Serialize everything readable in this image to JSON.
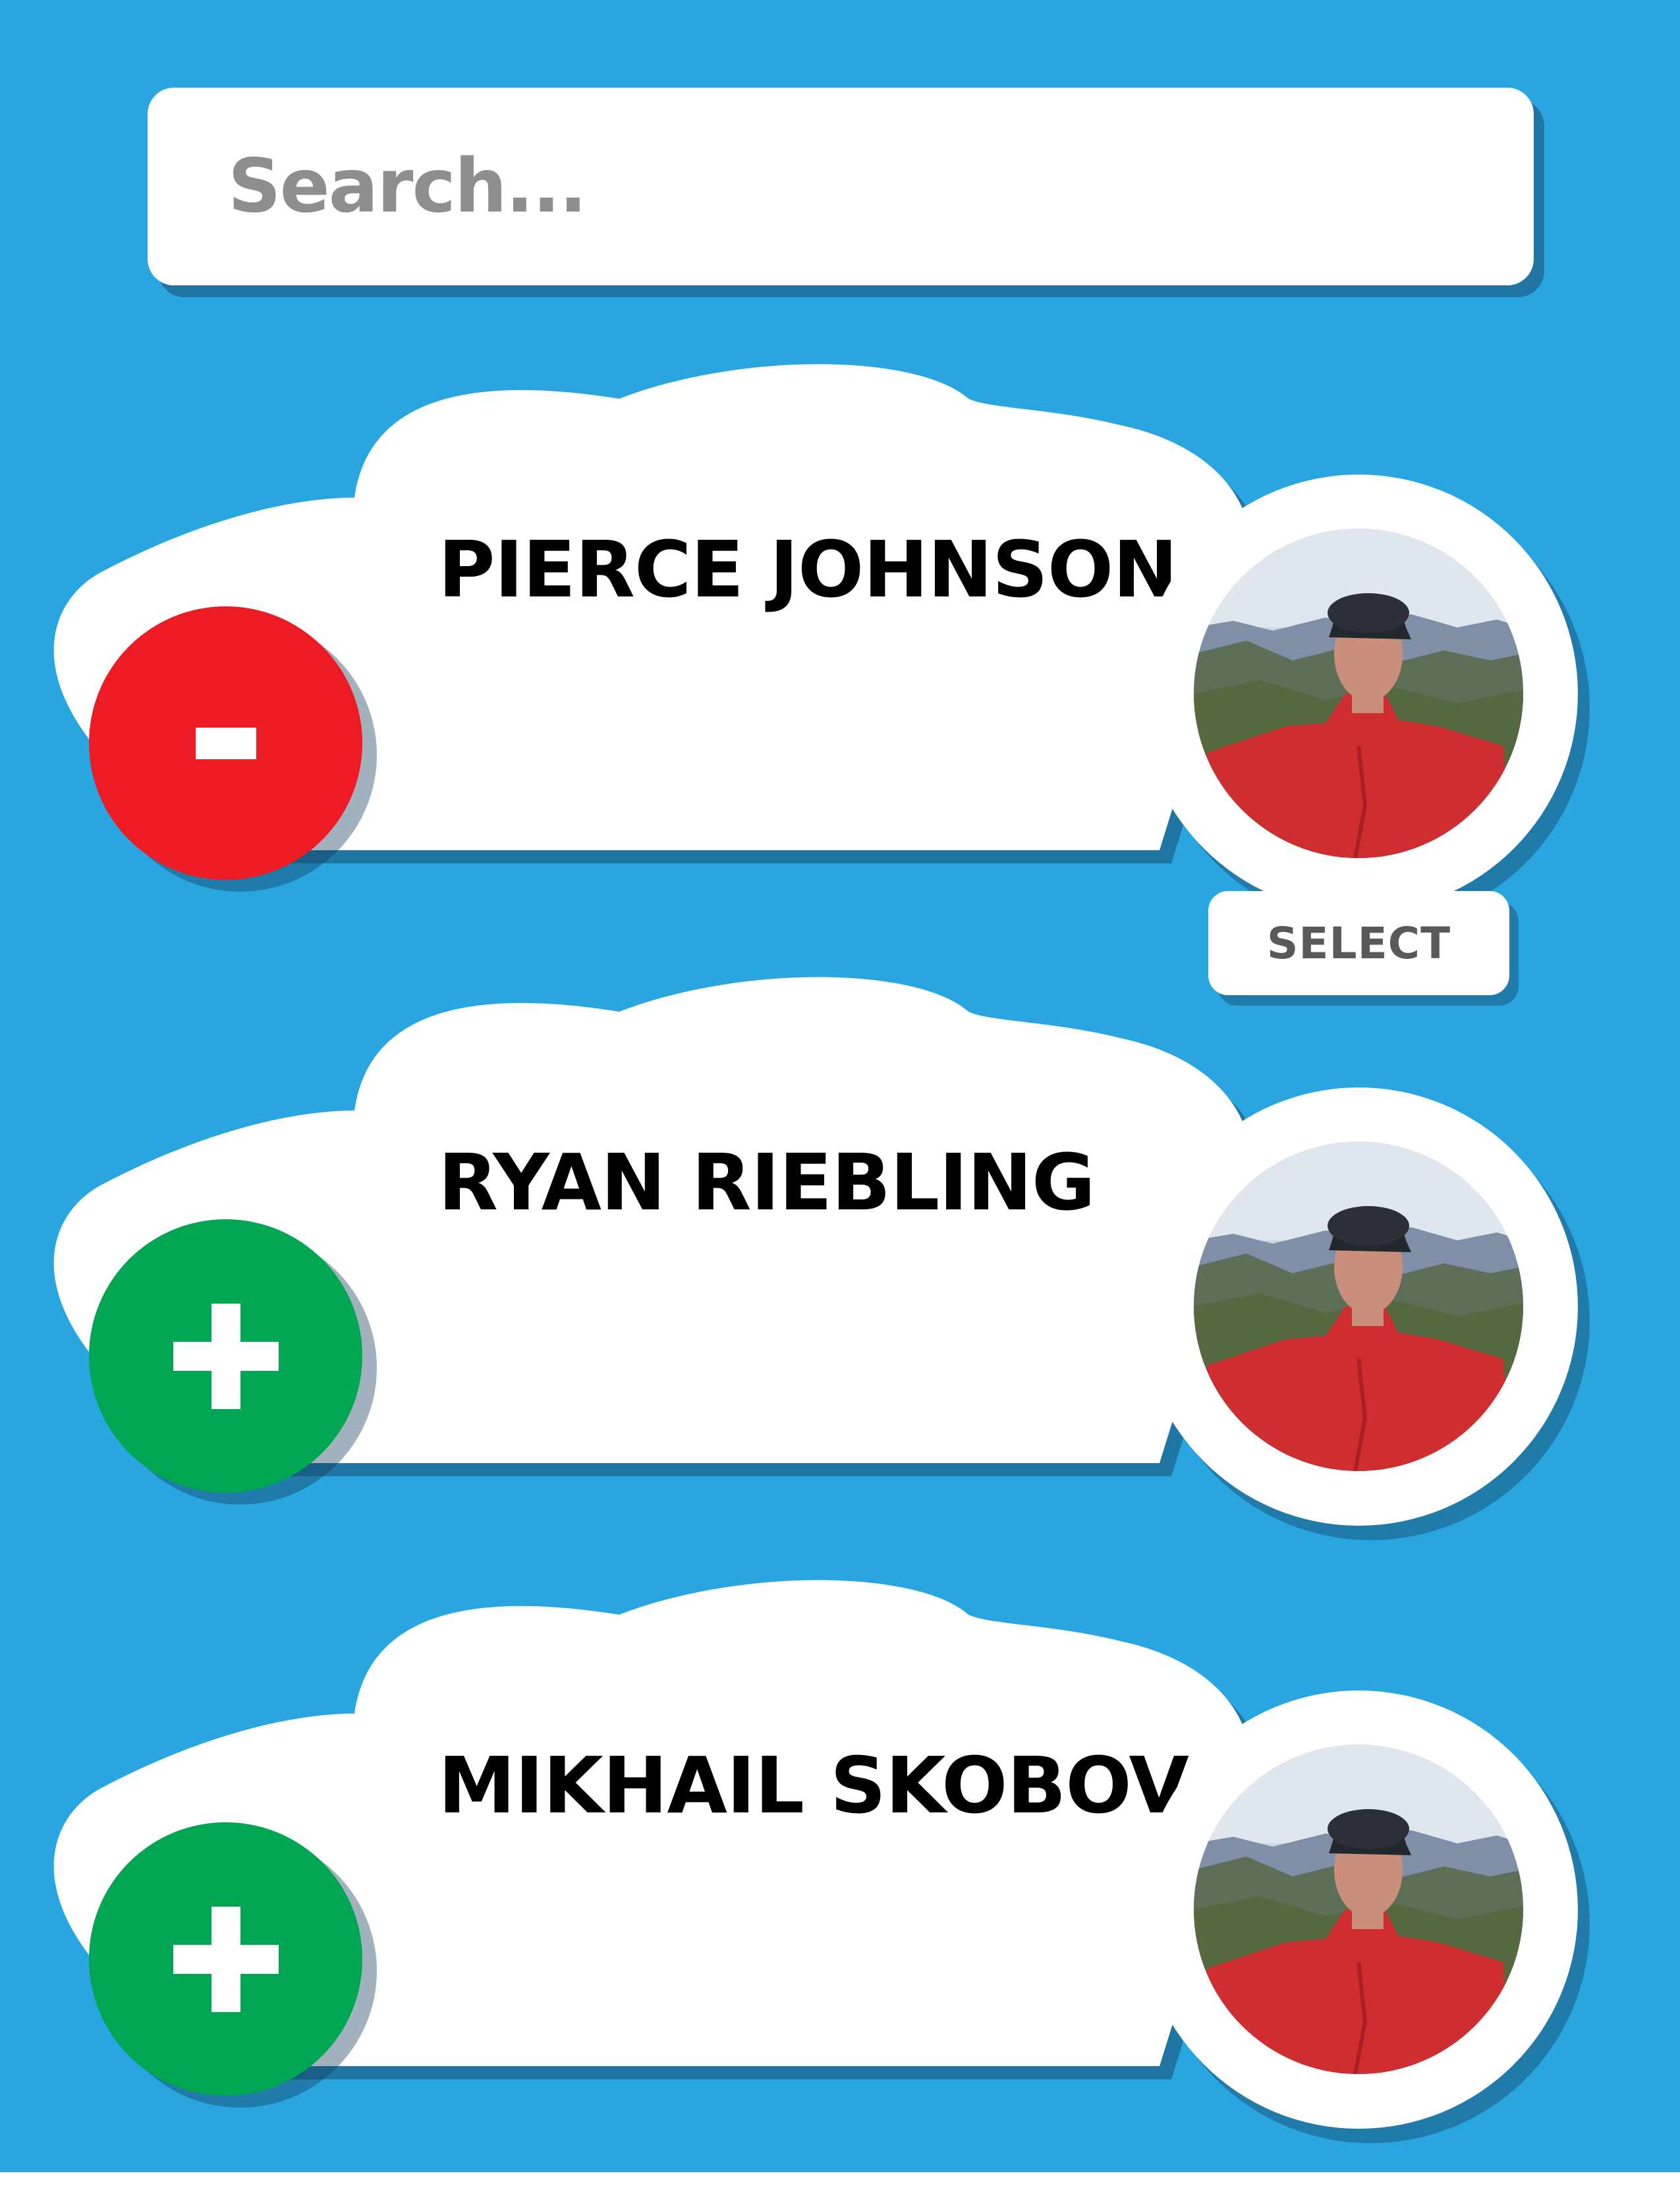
{
  "search": {
    "placeholder": "Search..."
  },
  "contacts": [
    {
      "name": "PIERCE JOHNSON",
      "action": "remove",
      "action_symbol": "minus",
      "avatar": "person-photo"
    },
    {
      "name": "RYAN RIEBLING",
      "action": "add",
      "action_symbol": "plus",
      "avatar": "person-photo"
    },
    {
      "name": "MIKHAIL SKOBOV",
      "action": "add",
      "action_symbol": "plus",
      "avatar": "person-photo"
    }
  ],
  "select_label": "SELECT",
  "colors": {
    "background": "#29a6df",
    "remove": "#ed1c24",
    "add": "#00a651",
    "card": "#ffffff",
    "placeholder_text": "#8d8e90",
    "select_text": "#58595b"
  }
}
